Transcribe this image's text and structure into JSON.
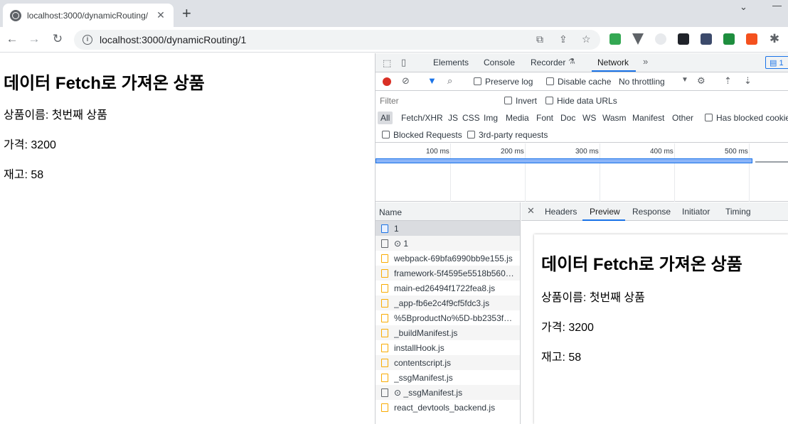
{
  "browser": {
    "tab_title": "localhost:3000/dynamicRouting/",
    "url": "localhost:3000/dynamicRouting/1"
  },
  "page": {
    "heading": "데이터 Fetch로 가져온 상품",
    "name_line": "상품이름: 첫번째 상품",
    "price_line": "가격: 3200",
    "stock_line": "재고: 58"
  },
  "devtools": {
    "tabs": [
      "Elements",
      "Console",
      "Recorder",
      "Network"
    ],
    "active_tab": "Network",
    "message_count": "1",
    "preserve_log": "Preserve log",
    "disable_cache": "Disable cache",
    "throttling": "No throttling",
    "filter_placeholder": "Filter",
    "invert": "Invert",
    "hide_data_urls": "Hide data URLs",
    "types": [
      "All",
      "Fetch/XHR",
      "JS",
      "CSS",
      "Img",
      "Media",
      "Font",
      "Doc",
      "WS",
      "Wasm",
      "Manifest",
      "Other"
    ],
    "has_blocked_cookies": "Has blocked cookies",
    "blocked_requests": "Blocked Requests",
    "third_party": "3rd-party requests",
    "ticks": [
      "100 ms",
      "200 ms",
      "300 ms",
      "400 ms",
      "500 ms"
    ],
    "list_header": "Name",
    "requests": [
      {
        "name": "1",
        "icon": "document-icon"
      },
      {
        "name": "⊙ 1",
        "icon": "blank-icon"
      },
      {
        "name": "webpack-69bfa6990bb9e155.js",
        "icon": "script-icon"
      },
      {
        "name": "framework-5f4595e5518b5600…",
        "icon": "script-icon"
      },
      {
        "name": "main-ed26494f1722fea8.js",
        "icon": "script-icon"
      },
      {
        "name": "_app-fb6e2c4f9cf5fdc3.js",
        "icon": "script-icon"
      },
      {
        "name": "%5BproductNo%5D-bb2353fb…",
        "icon": "script-icon"
      },
      {
        "name": "_buildManifest.js",
        "icon": "script-icon"
      },
      {
        "name": "installHook.js",
        "icon": "script-icon"
      },
      {
        "name": "contentscript.js",
        "icon": "script-icon"
      },
      {
        "name": "_ssgManifest.js",
        "icon": "script-icon"
      },
      {
        "name": "⊙ _ssgManifest.js",
        "icon": "blank-icon"
      },
      {
        "name": "react_devtools_backend.js",
        "icon": "script-icon"
      }
    ],
    "detail_tabs": [
      "Headers",
      "Preview",
      "Response",
      "Initiator",
      "Timing"
    ],
    "active_detail_tab": "Preview"
  },
  "preview": {
    "heading": "데이터 Fetch로 가져온 상품",
    "name_line": "상품이름: 첫번째 상품",
    "price_line": "가격: 3200",
    "stock_line": "재고: 58"
  }
}
